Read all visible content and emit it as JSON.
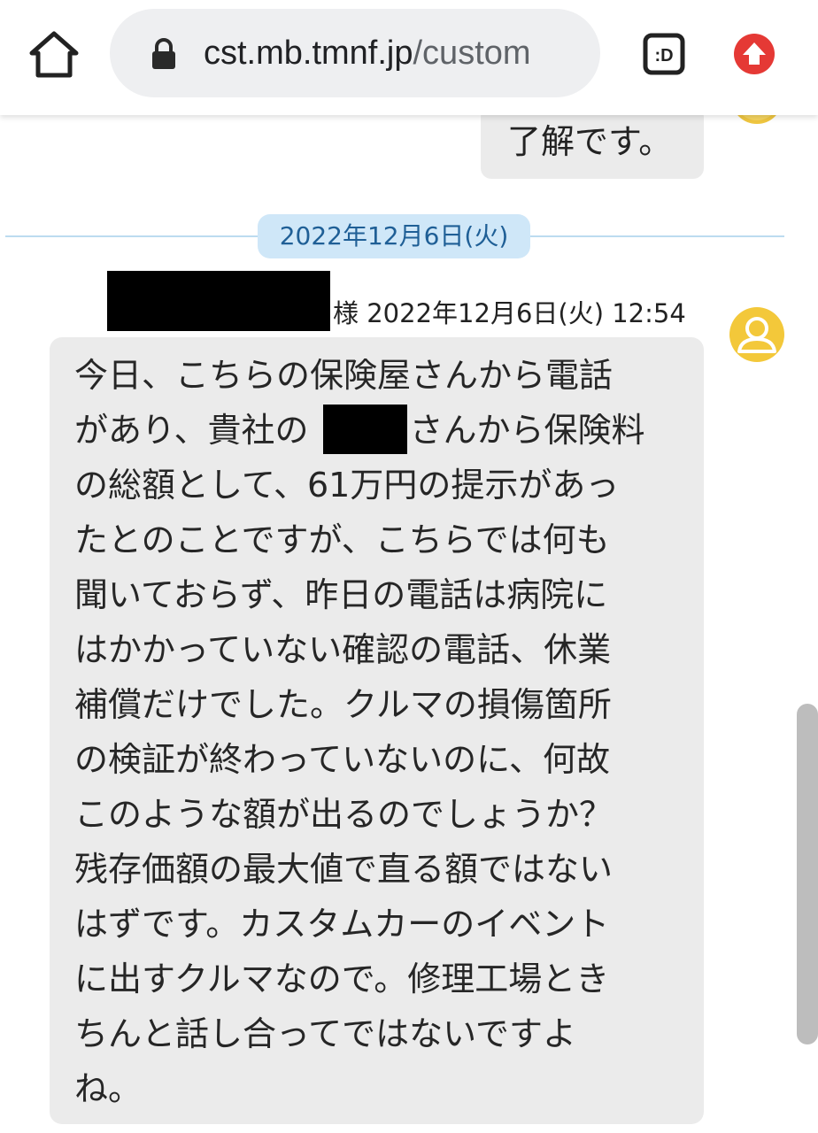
{
  "browser": {
    "url_host": "cst.mb.tmnf.jp",
    "url_path": "/custom",
    "tabs_icon_label": ":D",
    "icons": [
      "home-icon",
      "lock-icon",
      "tab-switcher-icon",
      "upload-arrow-icon"
    ],
    "accent_color": "#e53935"
  },
  "chat": {
    "outgoing_message": "了解です。",
    "date_separator": "2022年12月6日(火)",
    "incoming": {
      "sender_suffix": "様",
      "timestamp": "2022年12月6日(火) 12:54",
      "lines": [
        "今日、こちらの保険屋さんから電話",
        "があり、貴社の　　　さんから保険料",
        "の総額として、61万円の提示があっ",
        "たとのことですが、こちらでは何も",
        "聞いておらず、昨日の電話は病院に",
        "はかかっていない確認の電話、休業",
        "補償だけでした。クルマの損傷箇所",
        "の検証が終わっていないのに、何故",
        "このような額が出るのでしょうか？",
        "残存価額の最大値で直る額ではない",
        "はずです。カスタムカーのイベント",
        "に出すクルマなので。修理工場とき",
        "ちんと話し合ってではないですよ",
        "ね。"
      ]
    }
  },
  "colors": {
    "bubble": "#ebebeb",
    "date_pill": "#cfe7f8",
    "date_text": "#1f5f96",
    "avatar": "#f3c83a"
  }
}
